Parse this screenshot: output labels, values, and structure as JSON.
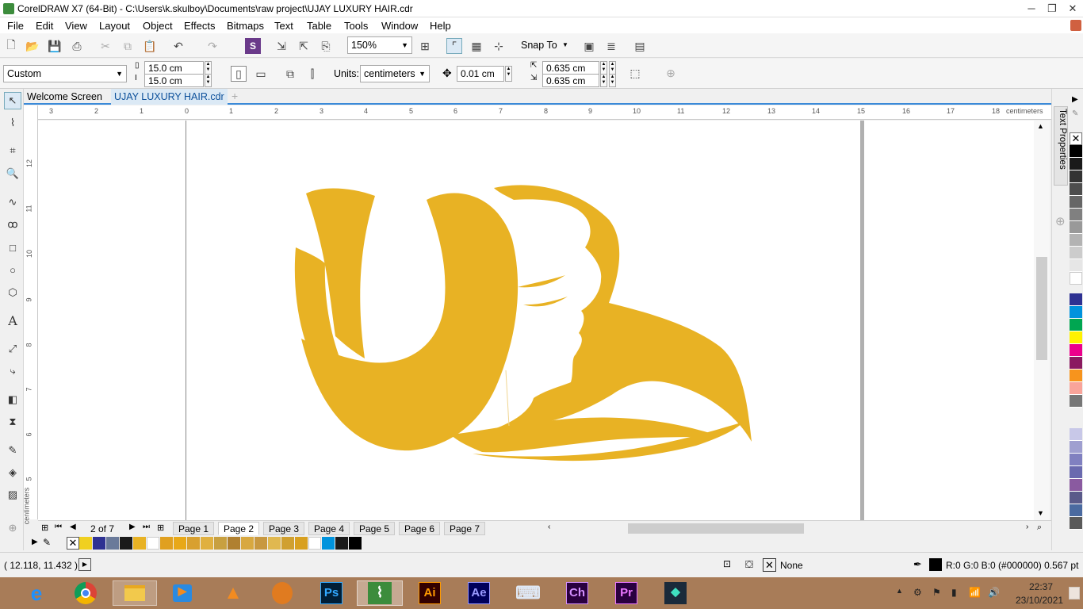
{
  "title": {
    "text": "CorelDRAW X7 (64-Bit) - C:\\Users\\k.skulboy\\Documents\\raw project\\UJAY LUXURY HAIR.cdr"
  },
  "menu": [
    "File",
    "Edit",
    "View",
    "Layout",
    "Object",
    "Effects",
    "Bitmaps",
    "Text",
    "Table",
    "Tools",
    "Window",
    "Help"
  ],
  "toolbar": {
    "zoom": "150%",
    "snap_to": "Snap To"
  },
  "propbar": {
    "page_preset": "Custom",
    "width": "15.0 cm",
    "height": "15.0 cm",
    "units_label": "Units:",
    "units_value": "centimeters",
    "nudge": "0.01 cm",
    "dup_x": "0.635 cm",
    "dup_y": "0.635 cm"
  },
  "doc_tabs": [
    "Welcome Screen",
    "UJAY LUXURY HAIR.cdr"
  ],
  "ruler": {
    "h_ticks": [
      "3",
      "2",
      "1",
      "0",
      "1",
      "2",
      "3",
      "4",
      "5",
      "6",
      "7",
      "8",
      "9",
      "10",
      "11",
      "12",
      "13",
      "14",
      "15",
      "16",
      "17",
      "18"
    ],
    "h_unit": "centimeters",
    "v_ticks": [
      "12",
      "11",
      "10",
      "9",
      "8",
      "7",
      "6",
      "5"
    ],
    "v_unit": "centimeters"
  },
  "side_panel": {
    "label": "Text Properties"
  },
  "page_nav": {
    "counter": "2 of 7",
    "pages": [
      "Page 1",
      "Page 2",
      "Page 3",
      "Page 4",
      "Page 5",
      "Page 6",
      "Page 7"
    ],
    "active": "Page 2"
  },
  "colors": {
    "logo": "#e8b224",
    "accent": "#3b8ad8",
    "palette": [
      "#ffffff",
      "#000000",
      "#1a1a1a",
      "#333333",
      "#4d4d4d",
      "#666666",
      "#808080",
      "#999999",
      "#b3b3b3",
      "#cccccc",
      "#e6e6e6",
      "#ffffff",
      "#2e3192",
      "#0093dd",
      "#00a651",
      "#fff200",
      "#ec008c",
      "#8b1a60",
      "#f7941d",
      "#f9a49a",
      "#777777",
      "#c8c8e8",
      "#9f9fd0",
      "#8080c0",
      "#6a6aaf",
      "#8a5aa0",
      "#5a5a8a",
      "#4a6aa0",
      "#5a5a5a"
    ],
    "document_palette": [
      "none",
      "#f0d020",
      "#2e3192",
      "#6a7a9a",
      "#1a1a1a",
      "#e8b224",
      "#ffffff",
      "#e0a020",
      "#e8a818",
      "#d8a030",
      "#e0b040",
      "#c8a040",
      "#b08030",
      "#d8a840",
      "#c89840",
      "#e0b850",
      "#d0a030",
      "#d8a020",
      "#ffffff",
      "#0093dd",
      "#1a1a1a",
      "#000000"
    ]
  },
  "status": {
    "coords": "( 12.118, 11.432 )",
    "fill": "None",
    "outline": "R:0 G:0 B:0 (#000000)  0.567 pt"
  },
  "taskbar": {
    "apps": [
      "Internet Explorer",
      "Chrome",
      "File Explorer",
      "Media Player",
      "VLC",
      "FL Studio",
      "Ps",
      "CorelDRAW",
      "Ai",
      "Ae",
      "Keyboard",
      "Ch",
      "Pr",
      "Filmora"
    ],
    "time": "22:37",
    "date": "23/10/2021"
  }
}
